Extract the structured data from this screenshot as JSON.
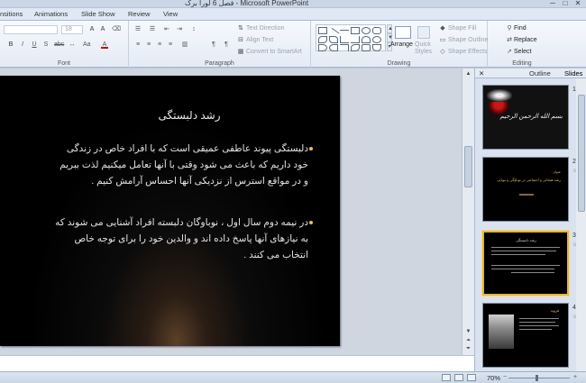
{
  "window": {
    "title": "فصل 6 لورا برک - Microsoft PowerPoint",
    "controls": [
      "─",
      "□",
      "✕"
    ]
  },
  "ribbon_tabs": [
    "nsitions",
    "Animations",
    "Slide Show",
    "Review",
    "View"
  ],
  "ribbon": {
    "font_size": "18",
    "font_group_label": "Font",
    "paragraph": {
      "text_direction": "Text Direction",
      "align_text": "Align Text",
      "convert_smartart": "Convert to SmartArt",
      "label": "Paragraph"
    },
    "drawing": {
      "arrange": "Arrange",
      "quick_styles": "Quick Styles",
      "shape_fill": "Shape Fill",
      "shape_outline": "Shape Outline",
      "shape_effects": "Shape Effects",
      "label": "Drawing"
    },
    "editing": {
      "find": "Find",
      "replace": "Replace",
      "select": "Select",
      "label": "Editing"
    }
  },
  "slide": {
    "title": "رشد دلبستگی",
    "bullets": [
      {
        "lines": [
          "دلبستگی پیوند عاطفی عمیقی است که با افراد خاص در زندگی",
          "خود داریم که باعث می شود وقتی با آنها تعامل میکنیم لذت ببریم",
          "و در مواقع استرس از نزدیکی آنها احساس آرامش کنیم ."
        ]
      },
      {
        "lines": [
          "در نیمه دوم سال اول ، نوباوگان دلبسته افراد آشنایی می شوند که",
          "به نیازهای آنها پاسخ داده اند و والدین خود را برای توجه خاص",
          "انتخاب می کنند ."
        ]
      }
    ]
  },
  "panel": {
    "tabs": {
      "outline": "Outline",
      "slides": "Slides"
    },
    "thumbs": [
      {
        "num": "1",
        "text": "بسم الله الرحمن الرحیم"
      },
      {
        "num": "2",
        "text": "عنوان :",
        "text2": "رشد هیجانی و اجتماعی در نوباوگی و نوپایی"
      },
      {
        "num": "3",
        "text": "رشد دلبستگی"
      },
      {
        "num": "4",
        "text": "فروید"
      }
    ]
  },
  "status": {
    "zoom": "70%"
  }
}
